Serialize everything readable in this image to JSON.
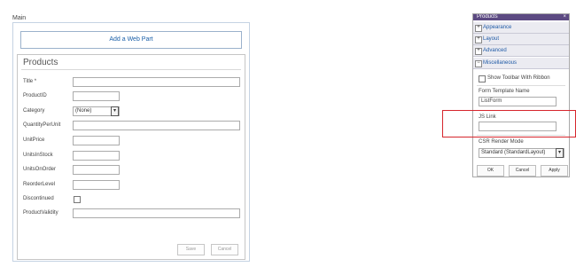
{
  "zone": {
    "label": "Main",
    "add_web_part": "Add a Web Part"
  },
  "form": {
    "title": "Products",
    "fields": [
      {
        "label": "Title *",
        "type": "wide"
      },
      {
        "label": "ProductID",
        "type": "narrow"
      },
      {
        "label": "Category",
        "type": "select",
        "value": "(None)"
      },
      {
        "label": "QuantityPerUnit",
        "type": "wide"
      },
      {
        "label": "UnitPrice",
        "type": "narrow"
      },
      {
        "label": "UnitsInStock",
        "type": "narrow"
      },
      {
        "label": "UnitsOnOrder",
        "type": "narrow"
      },
      {
        "label": "ReorderLevel",
        "type": "narrow"
      },
      {
        "label": "Discontinued",
        "type": "checkbox"
      },
      {
        "label": "ProductValidity",
        "type": "wide"
      }
    ],
    "save_label": "Save",
    "cancel_label": "Cancel"
  },
  "toolpane": {
    "header_title": "Products",
    "close_glyph": "×",
    "sections": [
      {
        "label": "Appearance",
        "expander": "+"
      },
      {
        "label": "Layout",
        "expander": "+"
      },
      {
        "label": "Advanced",
        "expander": "+"
      },
      {
        "label": "Miscellaneous",
        "expander": "−"
      }
    ],
    "show_toolbar_label": "Show Toolbar With Ribbon",
    "form_template_label": "Form Template Name",
    "form_template_value": "ListForm",
    "js_link_label": "JS Link",
    "js_link_value": "",
    "csr_label": "CSR Render Mode",
    "csr_value": "Standard (StandardLayout)",
    "ok_label": "OK",
    "cancel_label": "Cancel",
    "apply_label": "Apply"
  },
  "colors": {
    "highlight": "#d6262c",
    "header": "#5c4a82",
    "link": "#1f5aa6"
  }
}
